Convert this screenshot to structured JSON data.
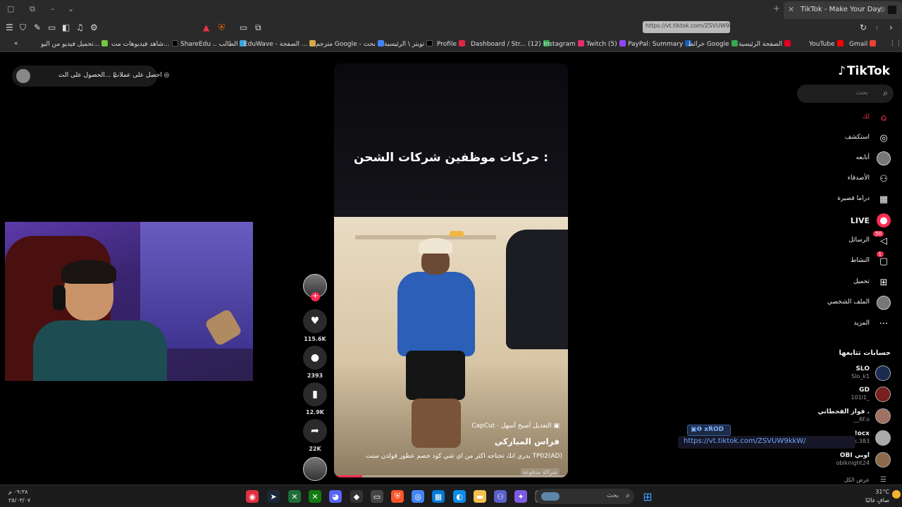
{
  "browser": {
    "tab_title": "TikTok - Make Your Day",
    "url_tooltip": "https://vt.tiktok.com/ZSVUW9kkW/",
    "bookmarks": [
      {
        "label": "Gmail",
        "color": "#ea4335"
      },
      {
        "label": "YouTube",
        "color": "#ff0000"
      },
      {
        "label": "الصفحة الرئيسية",
        "color": "#e60023"
      },
      {
        "label": "خرائط Google",
        "color": "#34a853"
      },
      {
        "label": "PayPal: Summary",
        "color": "#1b5fbd"
      },
      {
        "label": "Twitch (5)",
        "color": "#9146ff"
      },
      {
        "label": "Instagram",
        "color": "#e1306c"
      },
      {
        "label": "Dashboard / Str... (12)",
        "color": "#2ca84a"
      },
      {
        "label": "Profile",
        "color": "#e32644"
      },
      {
        "label": "تويتر \\ الرئيسية",
        "color": "#000000"
      },
      {
        "label": "مترجم Google - بحث",
        "color": "#4285f4"
      },
      {
        "label": "EduWave - الصفحة ...",
        "color": "#d6a84a"
      },
      {
        "label": "ShareEdu .. الطالب",
        "color": "#3aa3e0"
      },
      {
        "label": "شاهد فيديوهات مت...",
        "color": "#000000"
      },
      {
        "label": "تحميل فيديو من اليو...",
        "color": "#76c442"
      }
    ]
  },
  "coins": {
    "btn1": "احصل على عملات",
    "btn2": "الحصول على الت..."
  },
  "video": {
    "caption": "حركات موظفين شركات الشحن :",
    "capcut": "CapCut · التعديل أصبح أسهل",
    "author": "فراس المباركي",
    "description": "بدري انك تحتاجه اكثر من اي شي كود خصم عطور قولدن سنت TP02(AD)",
    "sponsored": "شراكة مدفوعة",
    "progress": 0.12
  },
  "actions": {
    "likes": "115.6K",
    "comments": "2393",
    "saves": "12.9K",
    "shares": "22K"
  },
  "tiktok": {
    "logo": "TikTok",
    "search_placeholder": "بحث",
    "nav": [
      {
        "label": "لك",
        "icon": "home-icon"
      },
      {
        "label": "استكشف",
        "icon": "compass-icon"
      },
      {
        "label": "أتابعه",
        "icon": "following-avatar"
      },
      {
        "label": "الأصدقاء",
        "icon": "friends-icon"
      },
      {
        "label": "دراما قصيرة",
        "icon": "film-icon"
      },
      {
        "label": "LIVE",
        "icon": "live-icon"
      },
      {
        "label": "الرسائل",
        "icon": "messages-icon",
        "badge": "50"
      },
      {
        "label": "النشاط",
        "icon": "activity-icon",
        "badge": "1"
      },
      {
        "label": "تحميل",
        "icon": "upload-icon"
      },
      {
        "label": "الملف الشخصي",
        "icon": "profile-avatar"
      },
      {
        "label": "المزيد",
        "icon": "more-icon"
      }
    ],
    "following_title": "حسابات تتابعها",
    "following": [
      {
        "name": "SLO",
        "handle": "Slo_k1"
      },
      {
        "name": "GD",
        "handle": "101l1_"
      },
      {
        "name": "فواز القحطاني .",
        "handle": "__6f.o"
      },
      {
        "name": "!ocx",
        "handle": "iocx.383"
      },
      {
        "name": "OBI اوبي",
        "handle": "obiknight24"
      }
    ],
    "see_all": "عرض الكل"
  },
  "overlay": {
    "badge": "xROD",
    "link": "https://vt.tiktok.com/ZSVUW9kkW/"
  },
  "taskbar": {
    "time": "٠٩:٣٨ م",
    "date": "٢٥/٠٣/٠٧",
    "search_placeholder": "بحث",
    "weather_temp": "31°C",
    "weather_desc": "صافٍ غالبًا"
  }
}
